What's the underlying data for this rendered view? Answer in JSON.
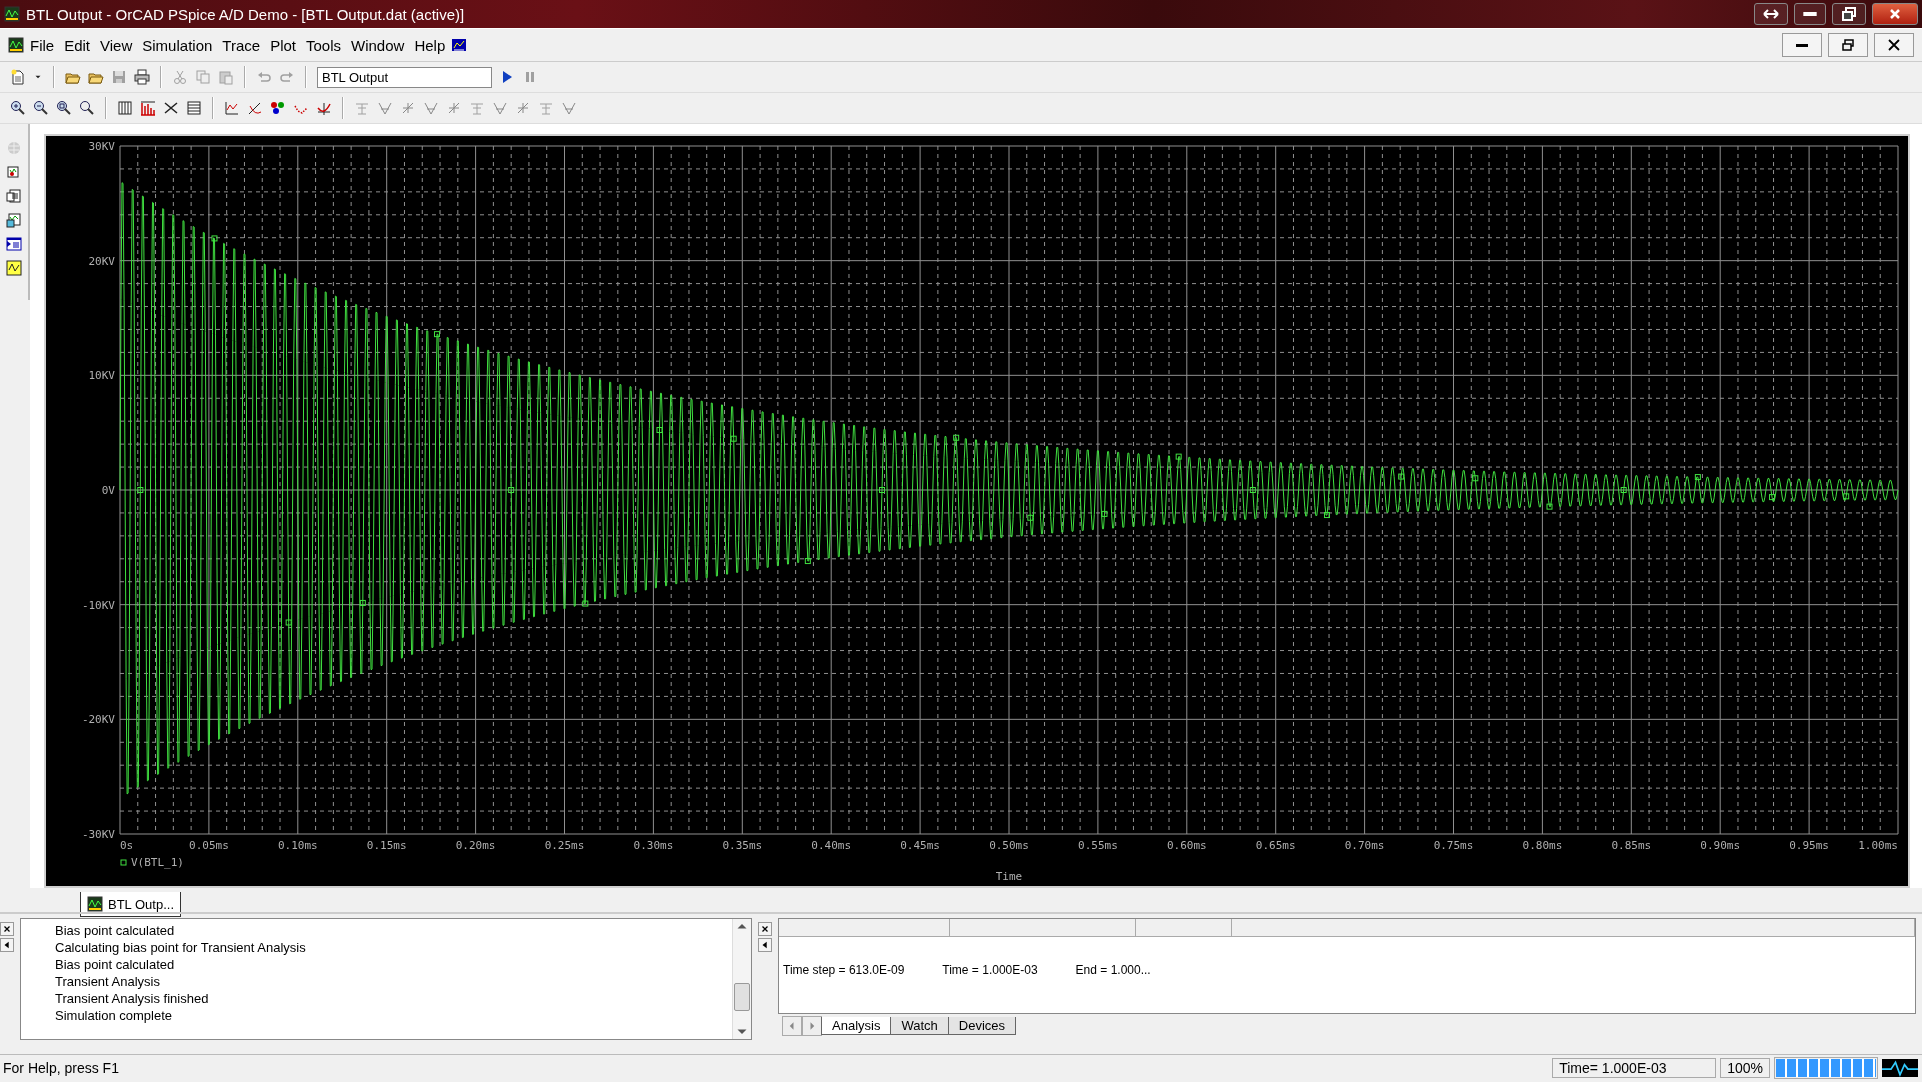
{
  "window": {
    "title": "BTL Output - OrCAD PSpice A/D Demo  - [BTL Output.dat (active)]"
  },
  "menu": [
    {
      "label": "File"
    },
    {
      "label": "Edit"
    },
    {
      "label": "View"
    },
    {
      "label": "Simulation"
    },
    {
      "label": "Trace"
    },
    {
      "label": "Plot"
    },
    {
      "label": "Tools"
    },
    {
      "label": "Window"
    },
    {
      "label": "Help"
    }
  ],
  "toolbar": {
    "profile": "BTL Output"
  },
  "plot": {
    "y_ticks": [
      "30KV",
      "20KV",
      "10KV",
      "0V",
      "-10KV",
      "-20KV",
      "-30KV"
    ],
    "x_ticks": [
      "0s",
      "0.05ms",
      "0.10ms",
      "0.15ms",
      "0.20ms",
      "0.25ms",
      "0.30ms",
      "0.35ms",
      "0.40ms",
      "0.45ms",
      "0.50ms",
      "0.55ms",
      "0.60ms",
      "0.65ms",
      "0.70ms",
      "0.75ms",
      "0.80ms",
      "0.85ms",
      "0.90ms",
      "0.95ms",
      "1.00ms"
    ],
    "x_axis_title": "Time",
    "legend": "V(BTL_1)"
  },
  "plot_tabs": [
    {
      "label": "BTL Outp...",
      "selected": true
    }
  ],
  "output_log": [
    "Bias point calculated",
    "Calculating bias point for Transient Analysis",
    "Bias point calculated",
    "Transient Analysis",
    "Transient Analysis finished",
    "Simulation complete"
  ],
  "simulation_status": [
    {
      "label": "Time step =",
      "value": "613.0E-09"
    },
    {
      "label": "Time =",
      "value": "1.000E-03"
    },
    {
      "label": "End =",
      "value": "1.000..."
    }
  ],
  "status_tabs": [
    {
      "label": "Analysis",
      "selected": true
    },
    {
      "label": "Watch",
      "selected": false
    },
    {
      "label": "Devices",
      "selected": false
    }
  ],
  "status_bar": {
    "help": "For Help, press F1",
    "time": "Time= 1.000E-03",
    "percent": "100%",
    "progress": {
      "level": 1
    }
  }
}
